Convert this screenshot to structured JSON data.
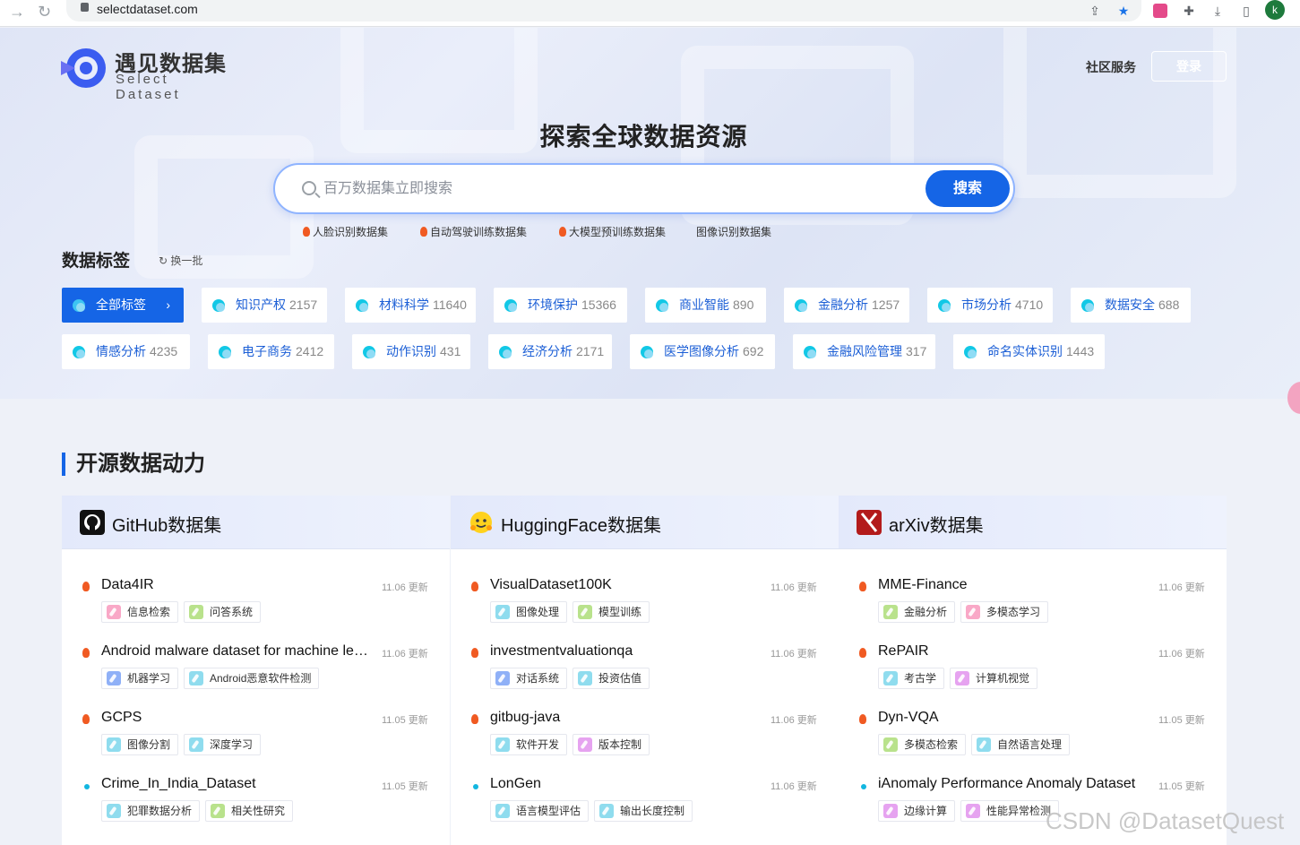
{
  "browser": {
    "url": "selectdataset.com",
    "avatar": "k"
  },
  "header": {
    "brand_cn": "遇见数据集",
    "brand_en": "Select Dataset",
    "community": "社区服务",
    "login": "登录"
  },
  "hero": {
    "title": "探索全球数据资源",
    "search_placeholder": "百万数据集立即搜索",
    "search_button": "搜索",
    "hot": [
      "人脸识别数据集",
      "自动驾驶训练数据集",
      "大模型预训练数据集",
      "图像识别数据集"
    ]
  },
  "tags": {
    "title": "数据标签",
    "refresh": "换一批",
    "items": [
      {
        "label": "全部标签",
        "count": ""
      },
      {
        "label": "知识产权",
        "count": "2157"
      },
      {
        "label": "材料科学",
        "count": "11640"
      },
      {
        "label": "环境保护",
        "count": "15366"
      },
      {
        "label": "商业智能",
        "count": "890"
      },
      {
        "label": "金融分析",
        "count": "1257"
      },
      {
        "label": "市场分析",
        "count": "4710"
      },
      {
        "label": "数据安全",
        "count": "688"
      },
      {
        "label": "情感分析",
        "count": "4235"
      },
      {
        "label": "电子商务",
        "count": "2412"
      },
      {
        "label": "动作识别",
        "count": "431"
      },
      {
        "label": "经济分析",
        "count": "2171"
      },
      {
        "label": "医学图像分析",
        "count": "692"
      },
      {
        "label": "金融风险管理",
        "count": "317"
      },
      {
        "label": "命名实体识别",
        "count": "1443"
      }
    ]
  },
  "section": {
    "title": "开源数据动力"
  },
  "columns": [
    {
      "title": "GitHub数据集",
      "items": [
        {
          "name": "Data4IR",
          "date": "11.06 更新",
          "tags": [
            "信息检索",
            "问答系统"
          ]
        },
        {
          "name": "Android malware dataset for machine learning",
          "date": "11.06 更新",
          "tags": [
            "机器学习",
            "Android恶意软件检测"
          ]
        },
        {
          "name": "GCPS",
          "date": "11.05 更新",
          "tags": [
            "图像分割",
            "深度学习"
          ]
        },
        {
          "name": "Crime_In_India_Dataset",
          "date": "11.05 更新",
          "tags": [
            "犯罪数据分析",
            "相关性研究"
          ]
        }
      ]
    },
    {
      "title": "HuggingFace数据集",
      "items": [
        {
          "name": "VisualDataset100K",
          "date": "11.06 更新",
          "tags": [
            "图像处理",
            "模型训练"
          ]
        },
        {
          "name": "investmentvaluationqa",
          "date": "11.06 更新",
          "tags": [
            "对话系统",
            "投资估值"
          ]
        },
        {
          "name": "gitbug-java",
          "date": "11.06 更新",
          "tags": [
            "软件开发",
            "版本控制"
          ]
        },
        {
          "name": "LonGen",
          "date": "11.06 更新",
          "tags": [
            "语言模型评估",
            "输出长度控制"
          ]
        }
      ]
    },
    {
      "title": "arXiv数据集",
      "items": [
        {
          "name": "MME-Finance",
          "date": "11.06 更新",
          "tags": [
            "金融分析",
            "多模态学习"
          ]
        },
        {
          "name": "RePAIR",
          "date": "11.06 更新",
          "tags": [
            "考古学",
            "计算机视觉"
          ]
        },
        {
          "name": "Dyn-VQA",
          "date": "11.05 更新",
          "tags": [
            "多模态检索",
            "自然语言处理"
          ]
        },
        {
          "name": "iAnomaly Performance Anomaly Dataset",
          "date": "11.05 更新",
          "tags": [
            "边缘计算",
            "性能异常检测"
          ]
        }
      ]
    }
  ],
  "watermark": "CSDN @DatasetQuest"
}
